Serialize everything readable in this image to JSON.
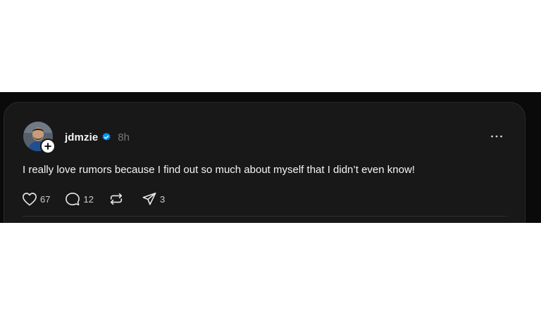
{
  "post": {
    "author": {
      "username": "jdmzie",
      "verified": true,
      "avatar_icon": "user-avatar",
      "follow_icon": "plus-icon"
    },
    "time": "8h",
    "text": "I really love rumors because I find out so much about myself that I didn’t even know!",
    "more_icon": "more-horizontal-icon",
    "actions": {
      "likes": "67",
      "replies": "12",
      "reposts": "",
      "shares": "3"
    }
  },
  "colors": {
    "page_background": "#ffffff",
    "band_background": "#0a0a0a",
    "card_background": "#181818",
    "text_primary": "#f3f5f7",
    "text_muted": "#777777",
    "verified_blue": "#0095f6"
  }
}
